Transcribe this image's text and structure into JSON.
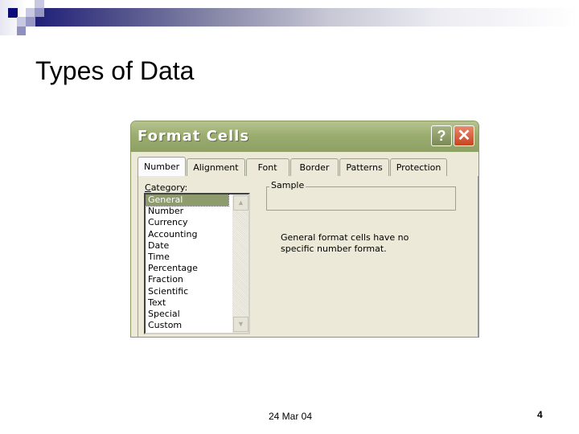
{
  "slide": {
    "title": "Types of Data",
    "footer_date": "24 Mar 04",
    "page_number": "4"
  },
  "dialog": {
    "title": "Format Cells",
    "help_label": "?",
    "close_label": "✕",
    "tabs": [
      {
        "label": "Number",
        "active": true
      },
      {
        "label": "Alignment"
      },
      {
        "label": "Font"
      },
      {
        "label": "Border"
      },
      {
        "label": "Patterns"
      },
      {
        "label": "Protection"
      }
    ],
    "category_label_accel": "C",
    "category_label_rest": "ategory:",
    "categories": [
      "General",
      "Number",
      "Currency",
      "Accounting",
      "Date",
      "Time",
      "Percentage",
      "Fraction",
      "Scientific",
      "Text",
      "Special",
      "Custom"
    ],
    "selected_category": "General",
    "sample_label": "Sample",
    "description": "General format cells have no specific number format.",
    "scroll_up": "▲",
    "scroll_down": "▼"
  }
}
